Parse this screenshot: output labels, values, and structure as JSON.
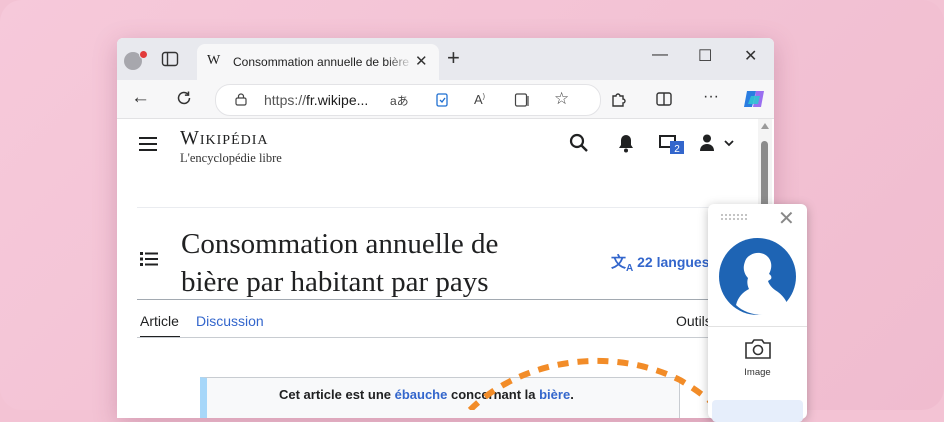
{
  "browser": {
    "tab": {
      "favicon_text": "W",
      "title": "Consommation annuelle de bière par habitant par pays — Wikipédia",
      "close": "✕"
    },
    "new_tab": "+",
    "window": {
      "minimize": "—",
      "maximize": "☐",
      "close": "✕"
    },
    "address": {
      "prefix": "https://",
      "domain": "fr.wikipe...",
      "read_aloud_text": "aあ"
    },
    "more": "···"
  },
  "wiki": {
    "logo": "Wikipédia",
    "tagline": "L'encyclopédie libre",
    "notification_count": "2",
    "title_line1": "Consommation annuelle de",
    "title_line2": "bière par habitant par pays",
    "languages": "22 langues",
    "tabs": {
      "article": "Article",
      "discussion": "Discussion",
      "tools": "Outils"
    },
    "notice": {
      "part1": "Cet article est une ",
      "link1": "ébauche",
      "part2": " concernant la ",
      "link2": "bière",
      "part3": "."
    }
  },
  "side_panel": {
    "close": "✕",
    "image_label": "Image"
  },
  "colors": {
    "accent_orange": "#f28c28",
    "link_blue": "#3366cc",
    "avatar_blue": "#1e64b4"
  }
}
